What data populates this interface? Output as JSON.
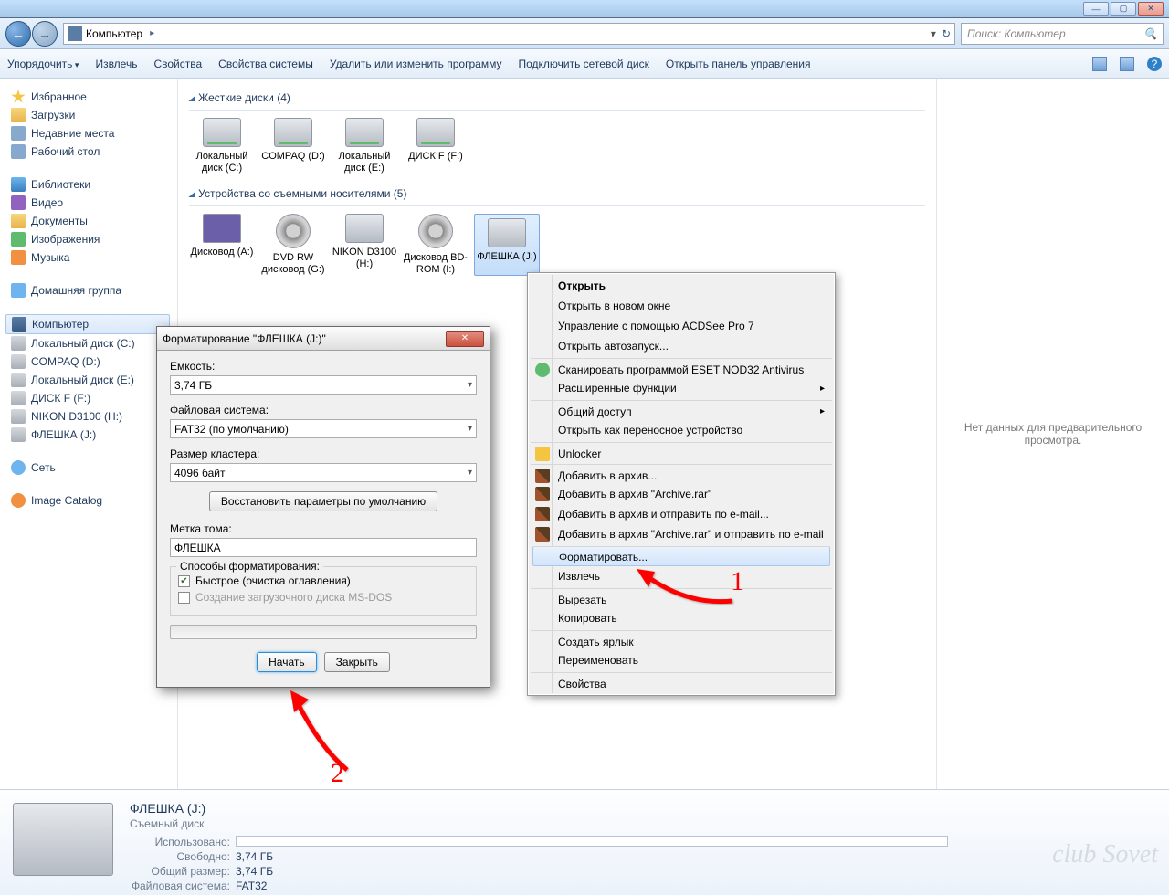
{
  "window": {
    "minimize": "—",
    "maximize": "▢",
    "close": "✕"
  },
  "nav": {
    "path_icon": "computer",
    "path": "Компьютер",
    "path_arrow": "▸",
    "refresh": "↻",
    "search_placeholder": "Поиск: Компьютер"
  },
  "toolbar": {
    "items": [
      "Упорядочить",
      "Извлечь",
      "Свойства",
      "Свойства системы",
      "Удалить или изменить программу",
      "Подключить сетевой диск",
      "Открыть панель управления"
    ]
  },
  "sidebar": {
    "favorites": {
      "title": "Избранное",
      "items": [
        "Загрузки",
        "Недавние места",
        "Рабочий стол"
      ]
    },
    "libraries": {
      "title": "Библиотеки",
      "items": [
        "Видео",
        "Документы",
        "Изображения",
        "Музыка"
      ]
    },
    "homegroup": "Домашняя группа",
    "computer": {
      "title": "Компьютер",
      "items": [
        "Локальный диск (C:)",
        "COMPAQ (D:)",
        "Локальный диск (E:)",
        "ДИСК F (F:)",
        "NIKON D3100 (H:)",
        "ФЛЕШКА (J:)"
      ]
    },
    "network": "Сеть",
    "catalog": "Image Catalog"
  },
  "content": {
    "group_hdd": "Жесткие диски (4)",
    "hdd": [
      "Локальный диск (C:)",
      "COMPAQ (D:)",
      "Локальный диск (E:)",
      "ДИСК F (F:)"
    ],
    "group_rem": "Устройства со съемными носителями (5)",
    "removable": [
      "Дисковод (A:)",
      "DVD RW дисковод (G:)",
      "NIKON D3100 (H:)",
      "Дисковод BD-ROM (I:)",
      "ФЛЕШКА (J:)"
    ]
  },
  "preview": "Нет данных для предварительного просмотра.",
  "details": {
    "title": "ФЛЕШКА (J:)",
    "subtitle": "Съемный диск",
    "used_label": "Использовано:",
    "free_label": "Свободно:",
    "free_val": "3,74 ГБ",
    "total_label": "Общий размер:",
    "total_val": "3,74 ГБ",
    "fs_label": "Файловая система:",
    "fs_val": "FAT32"
  },
  "context": {
    "items": [
      "Открыть",
      "Открыть в новом окне",
      "Управление с помощью ACDSee Pro 7",
      "Открыть автозапуск...",
      "Сканировать программой ESET NOD32 Antivirus",
      "Расширенные функции",
      "Общий доступ",
      "Открыть как переносное устройство",
      "Unlocker",
      "Добавить в архив...",
      "Добавить в архив \"Archive.rar\"",
      "Добавить в архив и отправить по e-mail...",
      "Добавить в архив \"Archive.rar\" и отправить по e-mail",
      "Форматировать...",
      "Извлечь",
      "Вырезать",
      "Копировать",
      "Создать ярлык",
      "Переименовать",
      "Свойства"
    ]
  },
  "dialog": {
    "title": "Форматирование \"ФЛЕШКА (J:)\"",
    "capacity_label": "Емкость:",
    "capacity_val": "3,74 ГБ",
    "fs_label": "Файловая система:",
    "fs_val": "FAT32 (по умолчанию)",
    "cluster_label": "Размер кластера:",
    "cluster_val": "4096 байт",
    "restore": "Восстановить параметры по умолчанию",
    "volume_label": "Метка тома:",
    "volume_val": "ФЛЕШКА",
    "fmt_group": "Способы форматирования:",
    "quick": "Быстрое (очистка оглавления)",
    "msdos": "Создание загрузочного диска MS-DOS",
    "start": "Начать",
    "close": "Закрыть"
  },
  "arrows": {
    "n1": "1",
    "n2": "2"
  },
  "watermark": "club Sovet"
}
